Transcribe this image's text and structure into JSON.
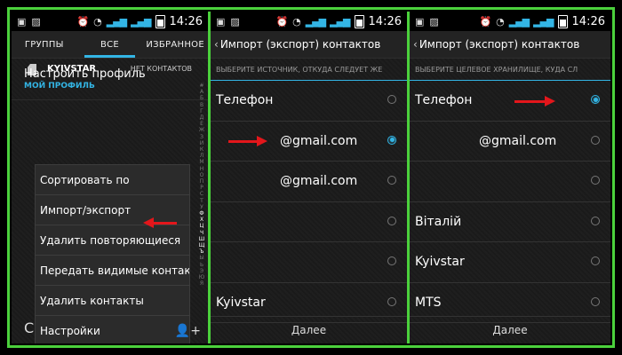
{
  "status": {
    "time": "14:26"
  },
  "screen1": {
    "tabs": [
      "ГРУППЫ",
      "ВСЕ",
      "ИЗБРАННОЕ"
    ],
    "profile_name": "KYIVSTAR",
    "no_contacts": "НЕТ КОНТАКТОВ",
    "my_profile": "МОЙ ПРОФИЛЬ",
    "setup_profile": "Настроить профиль",
    "alphabet": [
      "#",
      "А",
      "Б",
      "В",
      "Г",
      "Д",
      "Е",
      "Ж",
      "З",
      "И",
      "К",
      "Л",
      "М",
      "Н",
      "О",
      "П",
      "Р",
      "С",
      "Т",
      "У",
      "Ф",
      "Х",
      "Ц",
      "Ч",
      "Ш",
      "Щ",
      "Ъ",
      "Ы",
      "Ь",
      "Э",
      "Ю",
      "Я"
    ],
    "menu": [
      "Сортировать по",
      "Импорт/экспорт",
      "Удалить повторяющиеся",
      "Передать видимые контак",
      "Удалить контакты",
      "Настройки"
    ]
  },
  "screen2": {
    "title": "Импорт (экспорт) контактов",
    "subheader": "ВЫБЕРИТЕ ИСТОЧНИК, ОТКУДА СЛЕДУЕТ ЖЕ",
    "rows": [
      {
        "label": "Телефон",
        "selected": false
      },
      {
        "label": "@gmail.com",
        "selected": true
      },
      {
        "label": "@gmail.com",
        "selected": false
      },
      {
        "label": "",
        "selected": false
      },
      {
        "label": "",
        "selected": false
      },
      {
        "label": "Kyivstar",
        "selected": false
      }
    ],
    "next": "Далее"
  },
  "screen3": {
    "title": "Импорт (экспорт) контактов",
    "subheader": "ВЫБЕРИТЕ ЦЕЛЕВОЕ ХРАНИЛИЩЕ, КУДА СЛ",
    "rows": [
      {
        "label": "Телефон",
        "selected": true
      },
      {
        "label": "@gmail.com",
        "selected": false
      },
      {
        "label": "",
        "selected": false
      },
      {
        "label": "Віталій",
        "selected": false
      },
      {
        "label": "Kyivstar",
        "selected": false
      },
      {
        "label": "MTS",
        "selected": false
      }
    ],
    "next": "Далее"
  },
  "colors": {
    "accent": "#33b5e5",
    "frame": "#4bd13c",
    "arrow": "#e3161b"
  }
}
